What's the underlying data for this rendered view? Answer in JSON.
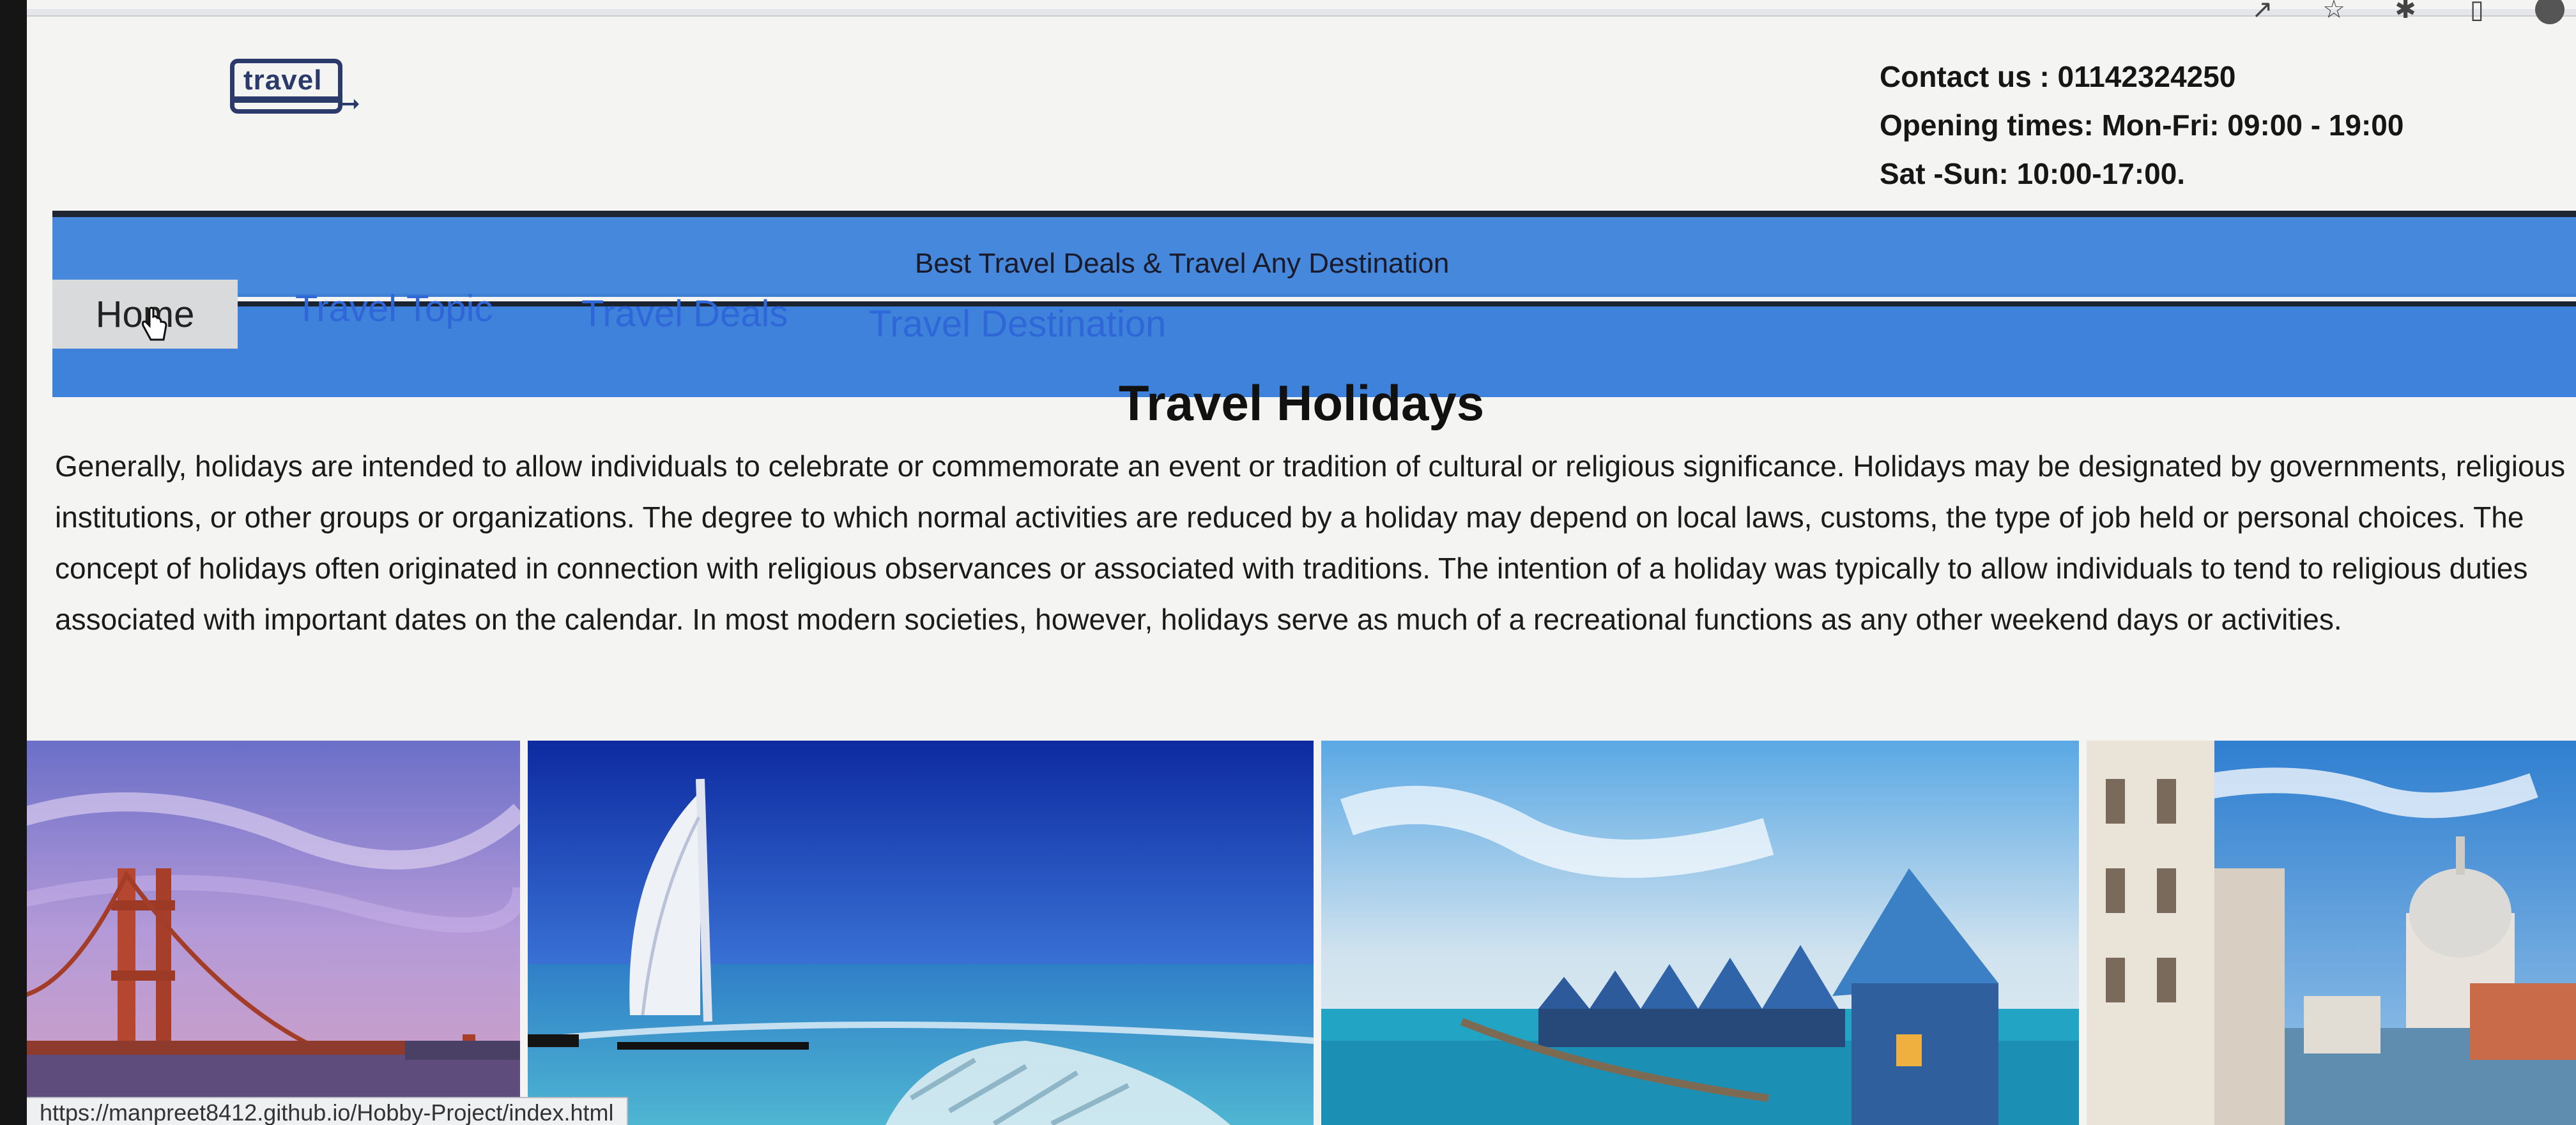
{
  "browser": {
    "status_url": "https://manpreet8412.github.io/Hobby-Project/index.html"
  },
  "header": {
    "logo_text": "travel",
    "contact_line": "Contact us : 01142324250",
    "opening_line": "Opening times: Mon-Fri: 09:00 - 19:00",
    "weekend_line": "Sat -Sun: 10:00-17:00."
  },
  "banner": {
    "tagline": "Best Travel Deals & Travel Any Destination"
  },
  "nav": {
    "items": [
      {
        "label": "Home"
      },
      {
        "label": "Travel Topic"
      },
      {
        "label": "Travel Deals"
      },
      {
        "label": "Travel Destination"
      }
    ]
  },
  "main": {
    "heading": "Travel Holidays",
    "paragraph": "Generally, holidays are intended to allow individuals to celebrate or commemorate an event or tradition of cultural or religious significance. Holidays may be designated by governments, religious institutions, or other groups or organizations. The degree to which normal activities are reduced by a holiday may depend on local laws, customs, the type of job held or personal choices. The concept of holidays often originated in connection with religious observances or associated with traditions. The intention of a holiday was typically to allow individuals to tend to religious duties associated with important dates on the calendar. In most modern societies, however, holidays serve as much of a recreational functions as any other weekend days or activities."
  },
  "gallery": {
    "photos": [
      {
        "subject": "golden-gate-bridge"
      },
      {
        "subject": "burj-al-arab"
      },
      {
        "subject": "overwater-bungalows"
      },
      {
        "subject": "venice-canal"
      }
    ]
  },
  "colors": {
    "nav_blue": "#3f82dc",
    "nav_link": "#2f66d8",
    "banner_border": "#1e2633",
    "home_tab_bg": "#d9dadb",
    "logo_navy": "#2a3b6b"
  }
}
